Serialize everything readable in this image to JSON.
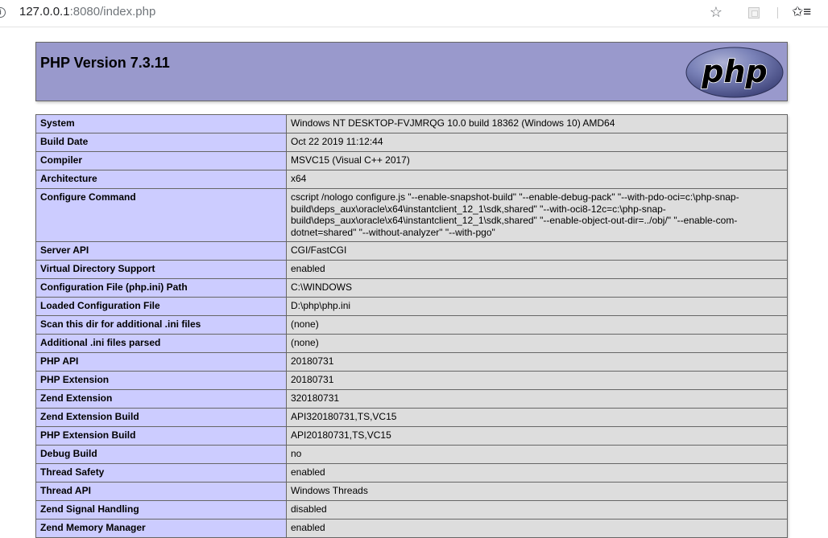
{
  "browser": {
    "url_host": "127.0.0.1",
    "url_rest": ":8080/index.php",
    "info_icon": "info-icon",
    "bookmark_icon": "star-icon",
    "extension_icon": "extension-icon",
    "favorites_icon": "favorites-icon"
  },
  "header": {
    "title": "PHP Version 7.3.11",
    "logo_text": "php",
    "bg_color": "#9999cc"
  },
  "colors": {
    "label_bg": "#ccccff",
    "value_bg": "#dddddd",
    "border": "#666666"
  },
  "rows": [
    {
      "label": "System",
      "value": "Windows NT DESKTOP-FVJMRQG 10.0 build 18362 (Windows 10) AMD64"
    },
    {
      "label": "Build Date",
      "value": "Oct 22 2019 11:12:44"
    },
    {
      "label": "Compiler",
      "value": "MSVC15 (Visual C++ 2017)"
    },
    {
      "label": "Architecture",
      "value": "x64"
    },
    {
      "label": "Configure Command",
      "value": "cscript /nologo configure.js \"--enable-snapshot-build\" \"--enable-debug-pack\" \"--with-pdo-oci=c:\\php-snap-build\\deps_aux\\oracle\\x64\\instantclient_12_1\\sdk,shared\" \"--with-oci8-12c=c:\\php-snap-build\\deps_aux\\oracle\\x64\\instantclient_12_1\\sdk,shared\" \"--enable-object-out-dir=../obj/\" \"--enable-com-dotnet=shared\" \"--without-analyzer\" \"--with-pgo\""
    },
    {
      "label": "Server API",
      "value": "CGI/FastCGI"
    },
    {
      "label": "Virtual Directory Support",
      "value": "enabled"
    },
    {
      "label": "Configuration File (php.ini) Path",
      "value": "C:\\WINDOWS"
    },
    {
      "label": "Loaded Configuration File",
      "value": "D:\\php\\php.ini"
    },
    {
      "label": "Scan this dir for additional .ini files",
      "value": "(none)"
    },
    {
      "label": "Additional .ini files parsed",
      "value": "(none)"
    },
    {
      "label": "PHP API",
      "value": "20180731"
    },
    {
      "label": "PHP Extension",
      "value": "20180731"
    },
    {
      "label": "Zend Extension",
      "value": "320180731"
    },
    {
      "label": "Zend Extension Build",
      "value": "API320180731,TS,VC15"
    },
    {
      "label": "PHP Extension Build",
      "value": "API20180731,TS,VC15"
    },
    {
      "label": "Debug Build",
      "value": "no"
    },
    {
      "label": "Thread Safety",
      "value": "enabled"
    },
    {
      "label": "Thread API",
      "value": "Windows Threads"
    },
    {
      "label": "Zend Signal Handling",
      "value": "disabled"
    },
    {
      "label": "Zend Memory Manager",
      "value": "enabled"
    }
  ]
}
